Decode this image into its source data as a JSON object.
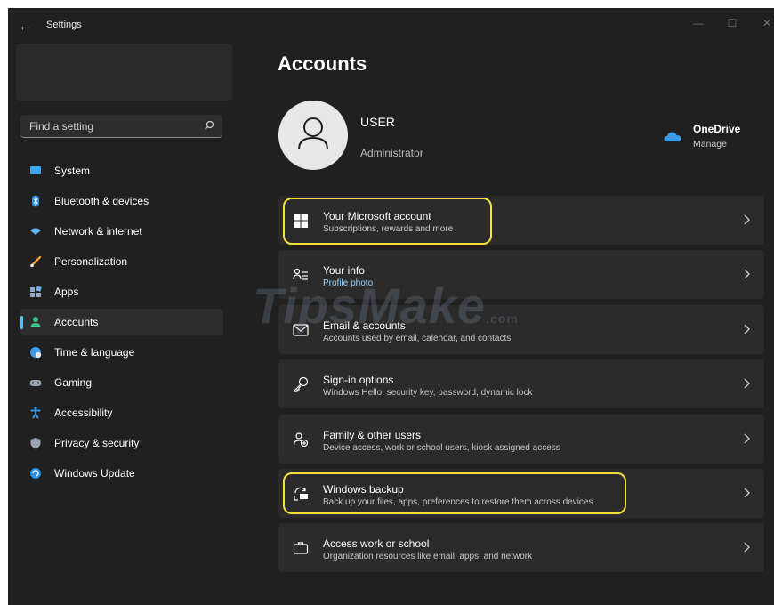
{
  "window": {
    "title": "Settings",
    "back_glyph": "←",
    "minimize_glyph": "—",
    "maximize_glyph": "☐",
    "close_glyph": "✕"
  },
  "search": {
    "placeholder": "Find a setting"
  },
  "sidebar": {
    "items": [
      {
        "label": "System",
        "icon": "monitor-icon"
      },
      {
        "label": "Bluetooth & devices",
        "icon": "bluetooth-icon"
      },
      {
        "label": "Network & internet",
        "icon": "wifi-icon"
      },
      {
        "label": "Personalization",
        "icon": "brush-icon"
      },
      {
        "label": "Apps",
        "icon": "apps-icon"
      },
      {
        "label": "Accounts",
        "icon": "person-icon",
        "active": true
      },
      {
        "label": "Time & language",
        "icon": "globe-clock-icon"
      },
      {
        "label": "Gaming",
        "icon": "controller-icon"
      },
      {
        "label": "Accessibility",
        "icon": "accessibility-icon"
      },
      {
        "label": "Privacy & security",
        "icon": "shield-icon"
      },
      {
        "label": "Windows Update",
        "icon": "update-icon"
      }
    ]
  },
  "main": {
    "title": "Accounts",
    "user": {
      "name": "USER",
      "role": "Administrator"
    },
    "onedrive": {
      "title": "OneDrive",
      "subtitle": "Manage"
    },
    "cards": [
      {
        "title": "Your Microsoft account",
        "subtitle": "Subscriptions, rewards and more",
        "icon": "windows-logo-icon"
      },
      {
        "title": "Your info",
        "subtitle": "Profile photo",
        "icon": "contact-card-icon"
      },
      {
        "title": "Email & accounts",
        "subtitle": "Accounts used by email, calendar, and contacts",
        "icon": "mail-icon"
      },
      {
        "title": "Sign-in options",
        "subtitle": "Windows Hello, security key, password, dynamic lock",
        "icon": "key-icon"
      },
      {
        "title": "Family & other users",
        "subtitle": "Device access, work or school users, kiosk assigned access",
        "icon": "people-add-icon"
      },
      {
        "title": "Windows backup",
        "subtitle": "Back up your files, apps, preferences to restore them across devices",
        "icon": "backup-icon"
      },
      {
        "title": "Access work or school",
        "subtitle": "Organization resources like email, apps, and network",
        "icon": "briefcase-icon"
      }
    ]
  },
  "watermark": {
    "text": "TipsMake",
    "suffix": ".com"
  },
  "colors": {
    "accent": "#4cc2ff",
    "highlight": "#f4e03a",
    "background": "#202020",
    "card": "#2b2b2b"
  }
}
